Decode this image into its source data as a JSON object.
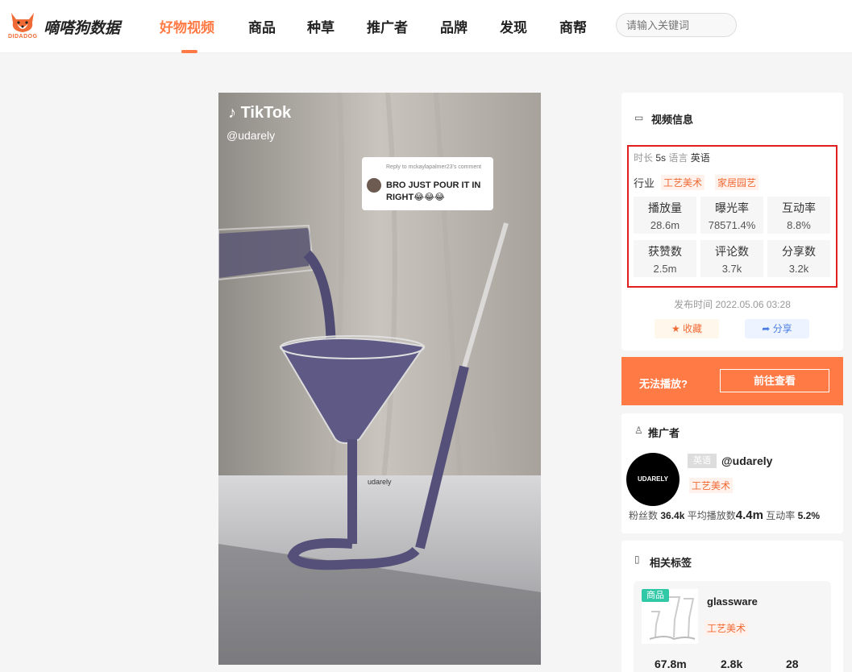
{
  "header": {
    "logo_name": "嘀嗒狗数据",
    "logo_sub": "DIDADOG",
    "nav": [
      "好物视频",
      "商品",
      "种草",
      "推广者",
      "品牌",
      "发现",
      "商帮"
    ],
    "search_placeholder": "请输入关键词"
  },
  "video": {
    "platform": "TikTok",
    "handle": "@udarely",
    "reply_to": "Reply to mckaylapalmer23's comment",
    "comment": "BRO JUST POUR IT IN RIGHT😂😂😂",
    "watermark": "udarely"
  },
  "info": {
    "title": "视频信息",
    "duration_label": "时长",
    "duration": "5s",
    "language_label": "语言",
    "language": "英语",
    "industry_label": "行业",
    "industry_tags": [
      "工艺美术",
      "家居园艺"
    ],
    "stats": [
      {
        "label": "播放量",
        "value": "28.6m"
      },
      {
        "label": "曝光率",
        "value": "78571.4%"
      },
      {
        "label": "互动率",
        "value": "8.8%"
      },
      {
        "label": "获赞数",
        "value": "2.5m"
      },
      {
        "label": "评论数",
        "value": "3.7k"
      },
      {
        "label": "分享数",
        "value": "3.2k"
      }
    ],
    "publish_time": "发布时间 2022.05.06 03:28",
    "fav_label": "收藏",
    "share_label": "分享"
  },
  "banner": {
    "question": "无法播放?",
    "button": "前往查看"
  },
  "promoter": {
    "title": "推广者",
    "avatar_text": "UDARELY",
    "lang_badge": "英语",
    "handle": "@udarely",
    "tag": "工艺美术",
    "fans_label": "粉丝数",
    "fans": "36.4k",
    "avg_play_label": "平均播放数",
    "avg_play": "4.4m",
    "engagement_label": "互动率",
    "engagement": "5.2%"
  },
  "tags": {
    "title": "相关标签",
    "badge": "商品",
    "name": "glassware",
    "tag": "工艺美术",
    "stats": [
      "67.8m",
      "2.8k",
      "28"
    ]
  },
  "colors": {
    "accent": "#ff7a45",
    "highlight_border": "#e02020"
  }
}
